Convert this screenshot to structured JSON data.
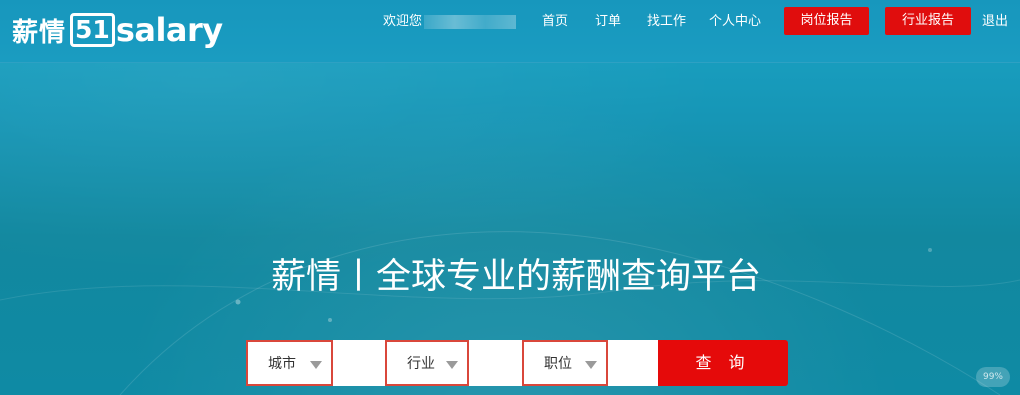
{
  "header": {
    "logo": {
      "cn": "薪情",
      "num": "51",
      "en": "salary"
    },
    "welcome_text": "欢迎您",
    "nav": [
      "首页",
      "订单",
      "找工作",
      "个人中心"
    ],
    "report_buttons": [
      "岗位报告",
      "行业报告"
    ],
    "logout": "退出"
  },
  "hero": {
    "headline": "薪情丨全球专业的薪酬查询平台"
  },
  "search": {
    "city": "城市",
    "industry": "行业",
    "position": "职位",
    "submit": "查 询"
  },
  "colors": {
    "header_bg": "#1797bd",
    "accent_red": "#e00d0d",
    "select_border": "#d9473b"
  },
  "watermark_label": "99%"
}
